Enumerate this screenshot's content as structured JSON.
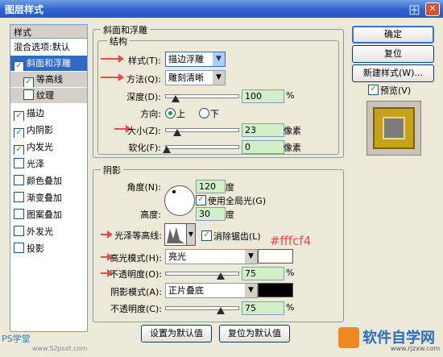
{
  "window": {
    "title": "图层样式",
    "close_glyph": "✕"
  },
  "left_panel": {
    "header": "样式",
    "blend_options": "混合选项:默认",
    "items": [
      {
        "label": "斜面和浮雕",
        "checked": true
      },
      {
        "label": "等高线",
        "checked": true
      },
      {
        "label": "纹理",
        "checked": false
      },
      {
        "label": "描边",
        "checked": true
      },
      {
        "label": "内阴影",
        "checked": true
      },
      {
        "label": "内发光",
        "checked": true
      },
      {
        "label": "光泽",
        "checked": false
      },
      {
        "label": "颜色叠加",
        "checked": false
      },
      {
        "label": "渐变叠加",
        "checked": false
      },
      {
        "label": "图案叠加",
        "checked": false
      },
      {
        "label": "外发光",
        "checked": false
      },
      {
        "label": "投影",
        "checked": false
      }
    ]
  },
  "bevel": {
    "section_title": "斜面和浮雕",
    "structure_title": "结构",
    "style_label": "样式(T):",
    "style_value": "描边浮雕",
    "technique_label": "方法(Q):",
    "technique_value": "雕刻清晰",
    "depth_label": "深度(D):",
    "depth_value": "100",
    "depth_unit": "%",
    "direction_label": "方向:",
    "dir_up": "上",
    "dir_down": "下",
    "size_label": "大小(Z):",
    "size_value": "23",
    "size_unit": "像素",
    "soften_label": "软化(F):",
    "soften_value": "0",
    "soften_unit": "像素"
  },
  "shading": {
    "title": "阴影",
    "angle_label": "角度(N):",
    "angle_value": "120",
    "angle_unit": "度",
    "global_light_label": "使用全局光(G)",
    "altitude_label": "高度:",
    "altitude_value": "30",
    "altitude_unit": "度",
    "gloss_label": "光泽等高线:",
    "antialias_label": "消除锯齿(L)",
    "highlight_mode_label": "高光模式(H):",
    "highlight_mode_value": "亮光",
    "highlight_color": "#fffcf4",
    "highlight_opacity_label": "不透明度(O):",
    "highlight_opacity_value": "75",
    "highlight_opacity_unit": "%",
    "shadow_mode_label": "阴影模式(A):",
    "shadow_mode_value": "正片叠底",
    "shadow_color": "#000000",
    "shadow_opacity_label": "不透明度(C):",
    "shadow_opacity_value": "75",
    "shadow_opacity_unit": "%",
    "annotation": "#fffcf4"
  },
  "buttons": {
    "ok": "确定",
    "reset": "复位",
    "new_style": "新建样式(W)...",
    "preview": "预览(V)",
    "make_default": "设置为默认值",
    "reset_default": "复位为默认值"
  },
  "watermarks": {
    "left": "PS学堂",
    "left_url": "www.52psxt.com",
    "right": "软件自学网",
    "right_url": "www.rjzxw.com"
  },
  "sliders": {
    "depth": 0.1,
    "size": 0.1,
    "soften": 0,
    "highlight_opacity": 0.75,
    "shadow_opacity": 0.75
  },
  "colors": {
    "annotation_red": "#e74c4c",
    "highlight_swatch": "#fffcf4",
    "shadow_swatch": "#000000"
  }
}
